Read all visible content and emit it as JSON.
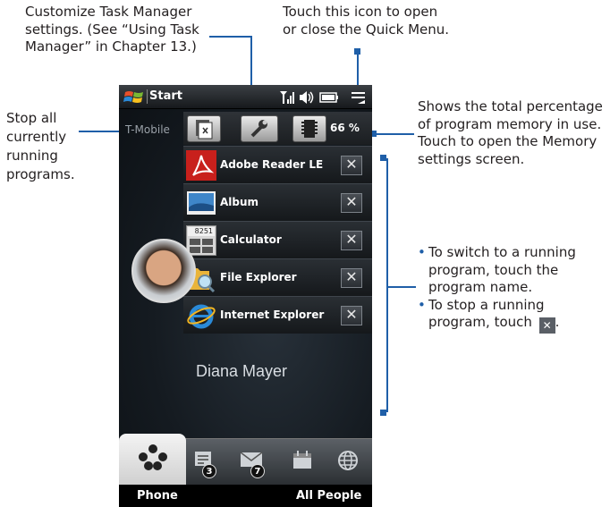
{
  "callouts": {
    "top_left": [
      "Customize Task Manager",
      "settings. (See “Using Task",
      "Manager” in Chapter 13.)"
    ],
    "top_right": [
      "Touch this icon to open",
      "or close the Quick Menu."
    ],
    "left": [
      "Stop all",
      "currently",
      "running",
      "programs."
    ],
    "right_top": [
      "Shows the total percentage",
      "of program memory in use.",
      "Touch to open the Memory",
      "settings screen."
    ],
    "right_bottom": [
      {
        "bullet": "•",
        "lines": [
          "To switch to a running",
          "program, touch the",
          "program name."
        ]
      },
      {
        "bullet": "•",
        "lines": [
          "To stop a running",
          "program, touch"
        ]
      }
    ]
  },
  "phone": {
    "title": "Start",
    "carrier": "T-Mobile",
    "status_icons": [
      "signal-icon",
      "speaker-icon",
      "battery-icon",
      "quick-menu-icon"
    ],
    "memory_percent": "66 %",
    "programs": [
      {
        "name": "Adobe Reader LE",
        "icon": "adobe-reader-icon"
      },
      {
        "name": "Album",
        "icon": "album-icon"
      },
      {
        "name": "Calculator",
        "icon": "calculator-icon"
      },
      {
        "name": "File Explorer",
        "icon": "file-explorer-icon"
      },
      {
        "name": "Internet Explorer",
        "icon": "internet-explorer-icon"
      }
    ],
    "close_glyph": "✕",
    "contact_name": "Diana Mayer",
    "tabs": [
      {
        "icon": "people-icon",
        "badge": ""
      },
      {
        "icon": "messages-icon",
        "badge": "3"
      },
      {
        "icon": "email-icon",
        "badge": "7"
      },
      {
        "icon": "calendar-icon",
        "badge": ""
      },
      {
        "icon": "internet-icon",
        "badge": ""
      }
    ],
    "left_softkey": "Phone",
    "right_softkey": "All People",
    "calculator_display": "8251"
  },
  "colors": {
    "accent": "#1f5fa8",
    "text": "#231f20"
  }
}
